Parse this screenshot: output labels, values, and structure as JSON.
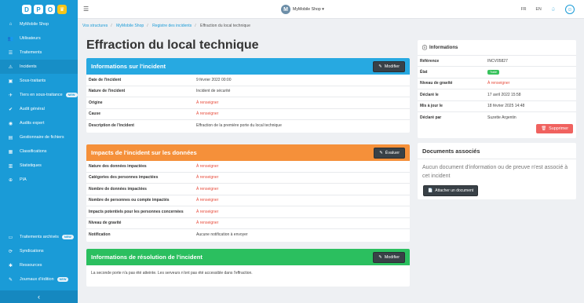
{
  "logo": {
    "letters": [
      "D",
      "P",
      "O"
    ],
    "crown": "♛"
  },
  "sidebar": {
    "items": [
      {
        "label": "MyMobile Shop",
        "icon": "home-icon"
      },
      {
        "label": "Utilisateurs",
        "icon": "users-icon"
      },
      {
        "label": "Traitements",
        "icon": "list-icon"
      },
      {
        "label": "Incidents",
        "icon": "alert-icon"
      },
      {
        "label": "Sous-traitants",
        "icon": "briefcase-icon"
      },
      {
        "label": "Tiers en sous-traitance",
        "icon": "plane-icon",
        "badge": "NEW"
      },
      {
        "label": "Audit général",
        "icon": "check-icon"
      },
      {
        "label": "Audits expert",
        "icon": "expert-icon"
      },
      {
        "label": "Gestionnaire de fichiers",
        "icon": "file-icon"
      },
      {
        "label": "Classifications",
        "icon": "grid-icon"
      },
      {
        "label": "Statistiques",
        "icon": "chart-icon"
      },
      {
        "label": "PIA",
        "icon": "pia-icon"
      }
    ],
    "bottom_items": [
      {
        "label": "Traitements archivés",
        "icon": "archive-icon",
        "badge": "NEW"
      },
      {
        "label": "Syndications",
        "icon": "sync-icon"
      },
      {
        "label": "Ressources",
        "icon": "puzzle-icon"
      },
      {
        "label": "Journaux d'édition",
        "icon": "journal-icon",
        "badge": "NEW"
      }
    ],
    "collapse": "‹"
  },
  "topbar": {
    "company_initial": "M",
    "company": "MyMobile Shop ▾",
    "lang_fr": "FR",
    "lang_en": "EN"
  },
  "breadcrumb": [
    "Vos structures",
    "MyMobile Shop",
    "Registre des incidents",
    "Effraction du local technique"
  ],
  "page_title": "Effraction du local technique",
  "incident_panel": {
    "title": "Informations sur l'incident",
    "button": "Modifier",
    "color": "#27a9e1",
    "rows": [
      {
        "k": "Date de l'incident",
        "v": "9 février 2022 00:00",
        "warn": false
      },
      {
        "k": "Nature de l'incident",
        "v": "Incident de sécurité",
        "warn": false
      },
      {
        "k": "Origine",
        "v": "À renseigner",
        "warn": true
      },
      {
        "k": "Cause",
        "v": "À renseigner",
        "warn": true
      },
      {
        "k": "Description de l'incident",
        "v": "Effraction de la première porte du local technique",
        "warn": false
      }
    ]
  },
  "impact_panel": {
    "title": "Impacts de l'incident sur les données",
    "button": "Évaluer",
    "color": "#f5903a",
    "rows": [
      {
        "k": "Nature des données impactées",
        "v": "À renseigner",
        "warn": true
      },
      {
        "k": "Catégories des personnes impactées",
        "v": "À renseigner",
        "warn": true
      },
      {
        "k": "Nombre de données impactées",
        "v": "À renseigner",
        "warn": true
      },
      {
        "k": "Nombre de personnes ou compte impactés",
        "v": "À renseigner",
        "warn": true
      },
      {
        "k": "Impacts potentiels pour les personnes concernées",
        "v": "À renseigner",
        "warn": true
      },
      {
        "k": "Niveau de gravité",
        "v": "À renseigner",
        "warn": true
      },
      {
        "k": "Notification",
        "v": "Aucune notification à envoyer",
        "warn": false
      }
    ]
  },
  "resolution_panel": {
    "title": "Informations de résolution de l'incident",
    "button": "Modifier",
    "color": "#2bbf5f",
    "text": "La seconde porte n'a pas été atteinte. Les serveurs n'ont pas été accessible dans l'effraction."
  },
  "info_side": {
    "title": "Informations",
    "rows": [
      {
        "k": "Référence",
        "v": "INCV05827",
        "type": "text"
      },
      {
        "k": "État",
        "v": "Traité",
        "type": "tag"
      },
      {
        "k": "Niveau de gravité",
        "v": "À renseigner",
        "type": "warn"
      },
      {
        "k": "Déclaré le",
        "v": "17 avril 2022 15:58",
        "type": "text"
      },
      {
        "k": "Mis à jour le",
        "v": "18 février 2025 14:48",
        "type": "text"
      },
      {
        "k": "Déclaré par",
        "v": "Suzette Argentin",
        "type": "text"
      }
    ],
    "delete": "Supprimer"
  },
  "docs": {
    "title": "Documents associés",
    "empty": "Aucun document d'information ou de preuve n'est associé à cet incident",
    "attach": "Attacher un document"
  }
}
